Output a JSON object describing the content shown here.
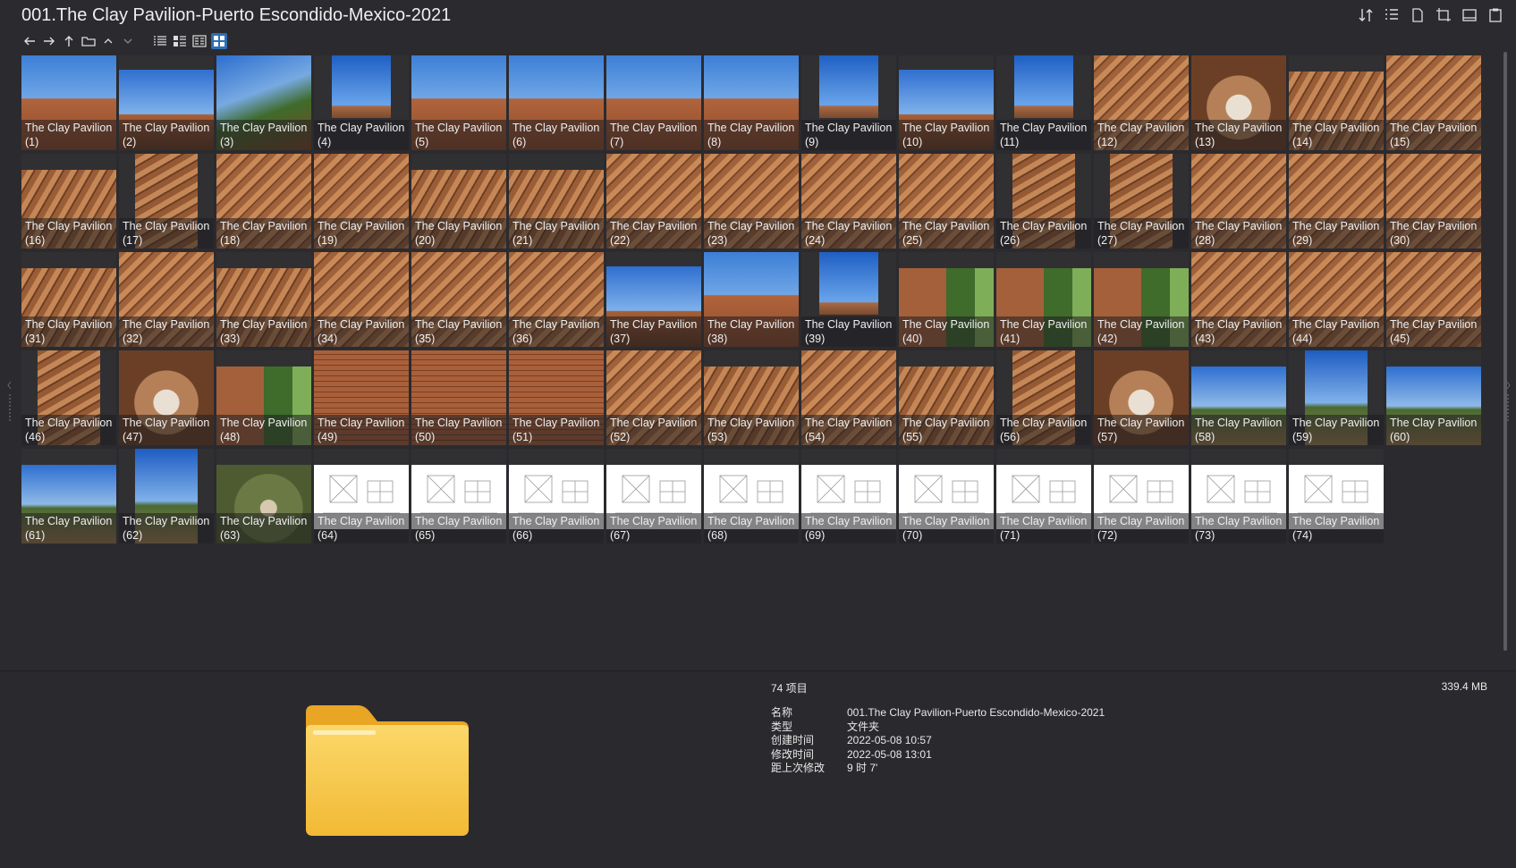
{
  "window": {
    "title": "001.The Clay Pavilion-Puerto Escondido-Mexico-2021"
  },
  "toolbar": {
    "nav_icons": [
      "arrow-left-icon",
      "arrow-right-icon",
      "arrow-up-icon",
      "folder-icon",
      "caret-up-icon",
      "caret-down-icon"
    ],
    "view_icons": [
      "list-view-icon",
      "details-view-icon",
      "tiles-view-icon",
      "thumbnails-view-icon"
    ],
    "right_icons": [
      "sort-icon",
      "filter-icon",
      "page-icon",
      "crop-icon",
      "panel-icon",
      "clipboard-icon"
    ]
  },
  "thumbnail_label": "The Clay Pavilion",
  "thumbnails": [
    {
      "n": "(1)",
      "kind": "brick-sky"
    },
    {
      "n": "(2)",
      "kind": "sky-wide"
    },
    {
      "n": "(3)",
      "kind": "tree-sky"
    },
    {
      "n": "(4)",
      "kind": "sky-tall"
    },
    {
      "n": "(5)",
      "kind": "brick-sky"
    },
    {
      "n": "(6)",
      "kind": "brick-sky"
    },
    {
      "n": "(7)",
      "kind": "brick-sky"
    },
    {
      "n": "(8)",
      "kind": "brick-sky"
    },
    {
      "n": "(9)",
      "kind": "sky-tall"
    },
    {
      "n": "(10)",
      "kind": "sky-wide"
    },
    {
      "n": "(11)",
      "kind": "sky-tall"
    },
    {
      "n": "(12)",
      "kind": "roof"
    },
    {
      "n": "(13)",
      "kind": "interior"
    },
    {
      "n": "(14)",
      "kind": "roof-wide"
    },
    {
      "n": "(15)",
      "kind": "roof"
    },
    {
      "n": "(16)",
      "kind": "roof-wide"
    },
    {
      "n": "(17)",
      "kind": "roof-tall"
    },
    {
      "n": "(18)",
      "kind": "roof"
    },
    {
      "n": "(19)",
      "kind": "roof"
    },
    {
      "n": "(20)",
      "kind": "roof-wide"
    },
    {
      "n": "(21)",
      "kind": "roof-wide"
    },
    {
      "n": "(22)",
      "kind": "roof"
    },
    {
      "n": "(23)",
      "kind": "roof"
    },
    {
      "n": "(24)",
      "kind": "roof"
    },
    {
      "n": "(25)",
      "kind": "roof"
    },
    {
      "n": "(26)",
      "kind": "roof-tall"
    },
    {
      "n": "(27)",
      "kind": "roof-tall"
    },
    {
      "n": "(28)",
      "kind": "roof"
    },
    {
      "n": "(29)",
      "kind": "roof"
    },
    {
      "n": "(30)",
      "kind": "roof"
    },
    {
      "n": "(31)",
      "kind": "roof-wide"
    },
    {
      "n": "(32)",
      "kind": "roof"
    },
    {
      "n": "(33)",
      "kind": "roof-wide"
    },
    {
      "n": "(34)",
      "kind": "roof"
    },
    {
      "n": "(35)",
      "kind": "roof"
    },
    {
      "n": "(36)",
      "kind": "roof"
    },
    {
      "n": "(37)",
      "kind": "sky-wide"
    },
    {
      "n": "(38)",
      "kind": "brick-sky"
    },
    {
      "n": "(39)",
      "kind": "sky-tall"
    },
    {
      "n": "(40)",
      "kind": "brick-tree"
    },
    {
      "n": "(41)",
      "kind": "brick-tree"
    },
    {
      "n": "(42)",
      "kind": "brick-tree"
    },
    {
      "n": "(43)",
      "kind": "roof"
    },
    {
      "n": "(44)",
      "kind": "roof"
    },
    {
      "n": "(45)",
      "kind": "roof"
    },
    {
      "n": "(46)",
      "kind": "roof-tall"
    },
    {
      "n": "(47)",
      "kind": "interior"
    },
    {
      "n": "(48)",
      "kind": "brick-tree"
    },
    {
      "n": "(49)",
      "kind": "brick"
    },
    {
      "n": "(50)",
      "kind": "brick"
    },
    {
      "n": "(51)",
      "kind": "brick"
    },
    {
      "n": "(52)",
      "kind": "roof"
    },
    {
      "n": "(53)",
      "kind": "roof-wide"
    },
    {
      "n": "(54)",
      "kind": "roof"
    },
    {
      "n": "(55)",
      "kind": "roof-wide"
    },
    {
      "n": "(56)",
      "kind": "roof-tall"
    },
    {
      "n": "(57)",
      "kind": "interior"
    },
    {
      "n": "(58)",
      "kind": "landscape"
    },
    {
      "n": "(59)",
      "kind": "landscape-tall"
    },
    {
      "n": "(60)",
      "kind": "landscape"
    },
    {
      "n": "(61)",
      "kind": "landscape"
    },
    {
      "n": "(62)",
      "kind": "landscape-tall"
    },
    {
      "n": "(63)",
      "kind": "aerial"
    },
    {
      "n": "(64)",
      "kind": "drawing"
    },
    {
      "n": "(65)",
      "kind": "drawing"
    },
    {
      "n": "(66)",
      "kind": "drawing"
    },
    {
      "n": "(67)",
      "kind": "drawing"
    },
    {
      "n": "(68)",
      "kind": "drawing"
    },
    {
      "n": "(69)",
      "kind": "drawing"
    },
    {
      "n": "(70)",
      "kind": "drawing"
    },
    {
      "n": "(71)",
      "kind": "drawing"
    },
    {
      "n": "(72)",
      "kind": "drawing"
    },
    {
      "n": "(73)",
      "kind": "drawing"
    },
    {
      "n": "(74)",
      "kind": "drawing"
    }
  ],
  "preview": {
    "item_count": "74 项目",
    "total_size": "339.4 MB",
    "fields": [
      {
        "key": "名称",
        "value": "001.The Clay Pavilion-Puerto Escondido-Mexico-2021"
      },
      {
        "key": "类型",
        "value": "文件夹"
      },
      {
        "key": "创建时间",
        "value": "2022-05-08  10:57"
      },
      {
        "key": "修改时间",
        "value": "2022-05-08  13:01"
      },
      {
        "key": "距上次修改",
        "value": "9 时 7'"
      }
    ]
  },
  "colors": {
    "background": "#2b2b2f",
    "accent": "#2d6fb5",
    "folder": "#f5c542"
  }
}
